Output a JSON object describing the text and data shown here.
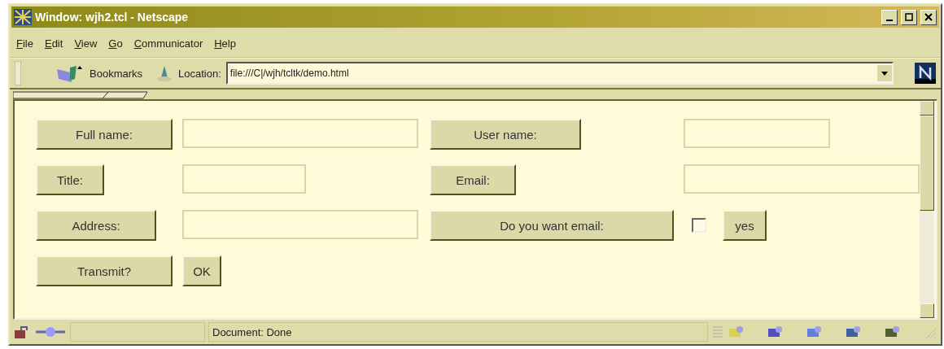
{
  "window": {
    "title": "Window: wjh2.tcl - Netscape"
  },
  "menu": [
    "File",
    "Edit",
    "View",
    "Go",
    "Communicator",
    "Help"
  ],
  "toolbar": {
    "bookmarks": "Bookmarks",
    "location_label": "Location:",
    "location": "file:///C|/wjh/tcltk/demo.html"
  },
  "form": {
    "rows": [
      {
        "label": "Full name:",
        "kind": "input",
        "control_label": "User name:",
        "right": {
          "kind": "input"
        }
      },
      {
        "label": "Title:",
        "kind": "input",
        "control_label": "Email:",
        "right": {
          "kind": "input"
        }
      },
      {
        "label": "Address:",
        "kind": "input",
        "control_label": "Do you want email:",
        "right": {
          "kind": "checkbox",
          "checked": false,
          "button": "yes"
        }
      },
      {
        "label": "Transmit?",
        "kind": "button",
        "button": "OK"
      }
    ]
  },
  "status_bar": {
    "text": "Document: Done"
  }
}
